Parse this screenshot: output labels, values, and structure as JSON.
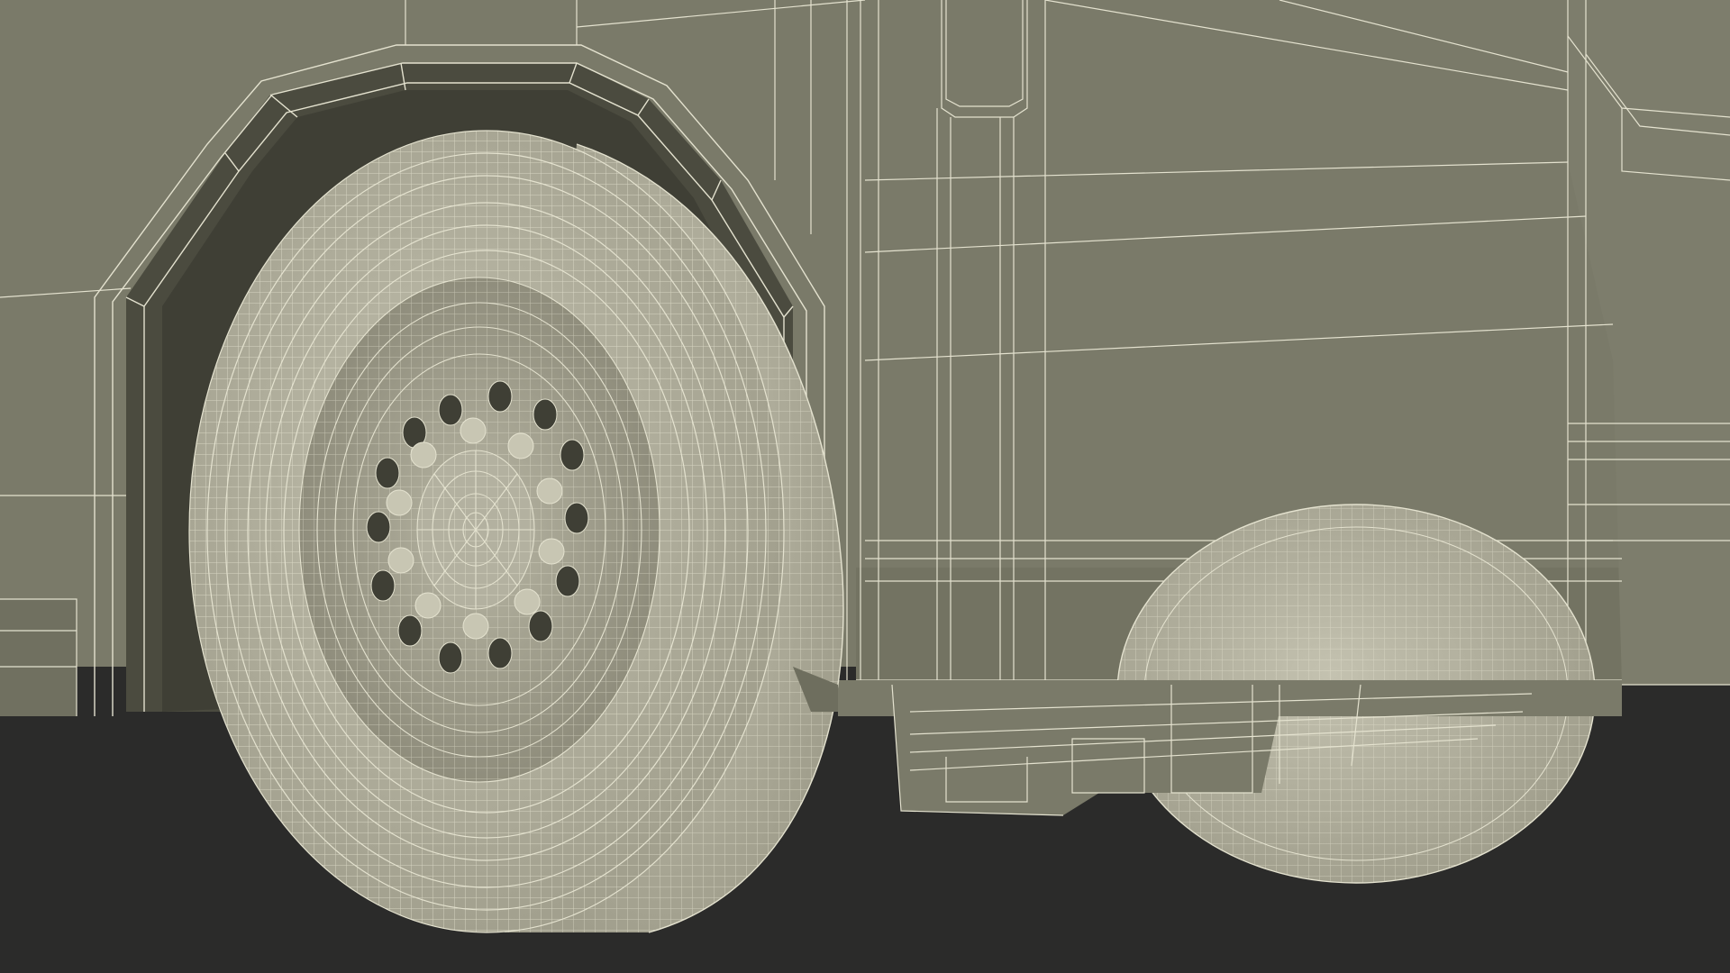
{
  "scene": {
    "subject": "truck-wheel-wireframe-render",
    "colors": {
      "body": "#7a7a69",
      "body_shadow": "#5c5c4e",
      "wheel_well": "#4a4a3e",
      "ground": "#2b2b2a",
      "wire": "#e4e2cf",
      "wire_dim": "#c9c7b4",
      "tire": "#b6b4a2",
      "hub": "#9c9a88"
    }
  }
}
